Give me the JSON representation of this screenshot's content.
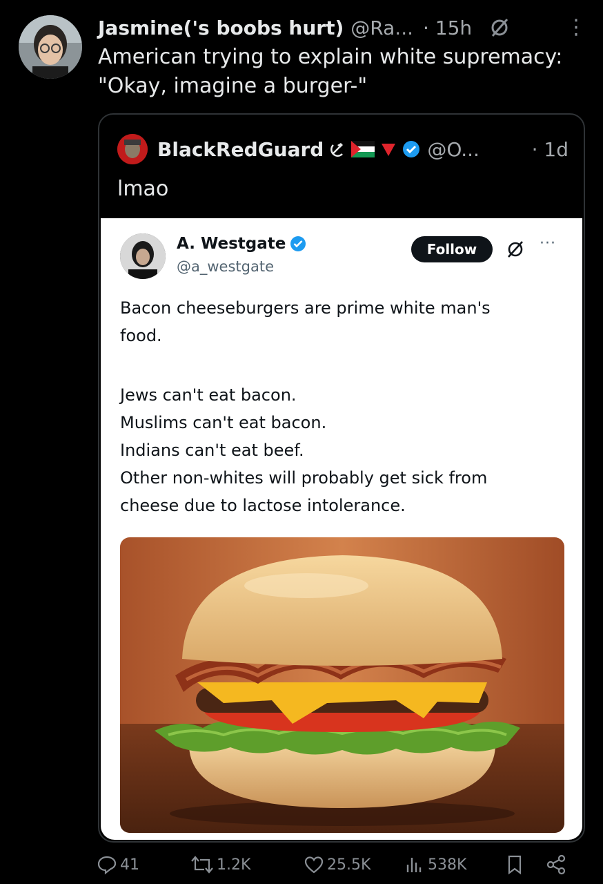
{
  "tweet": {
    "display_name": "Jasmine('s boobs hurt)",
    "handle": "@Ra...",
    "time": "· 15h",
    "more": "⋮",
    "text": "American trying to explain white supremacy:\n\"Okay, imagine a burger-\""
  },
  "quote": {
    "display_name": "BlackRedGuard",
    "handle": "@O...",
    "time": "· 1d",
    "text": "lmao",
    "colors": {
      "verified": "#1d9bf0",
      "flag_red": "#e0242c",
      "flag_green": "#149954"
    }
  },
  "screenshot": {
    "display_name": "A. Westgate",
    "handle": "@a_westgate",
    "follow_label": "Follow",
    "more": "···",
    "lines": [
      "Bacon cheeseburgers are prime white man's",
      "food.",
      "Jews can't eat bacon.",
      "Muslims can't eat bacon.",
      "Indians can't eat beef.",
      "Other non-whites will probably get sick from",
      "cheese due to lactose intolerance."
    ]
  },
  "actions": {
    "replies": "41",
    "reposts": "1.2K",
    "likes": "25.5K",
    "views": "538K"
  }
}
